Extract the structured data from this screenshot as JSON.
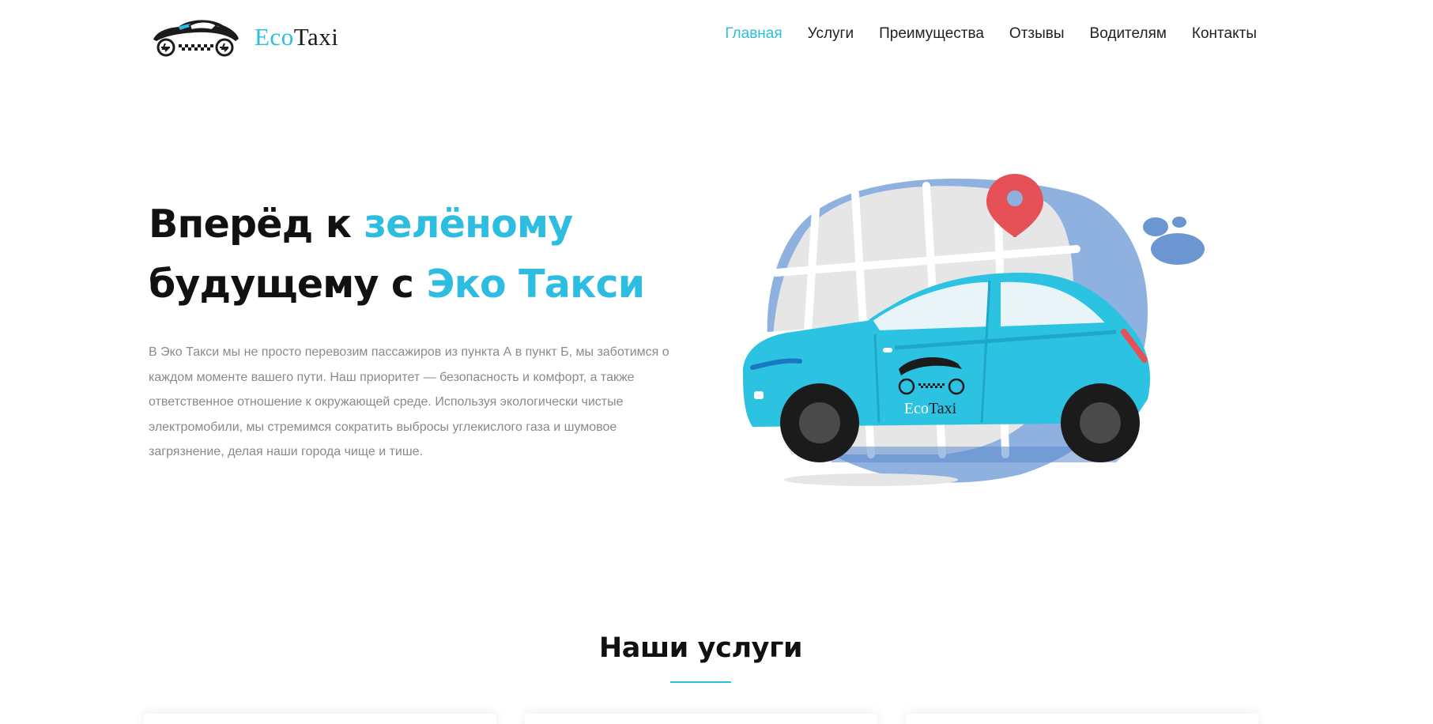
{
  "brand": {
    "name_part1": "Eco",
    "name_part2": "Taxi",
    "colors": {
      "accent": "#2cbde0",
      "text": "#111111",
      "muted": "#8a8a8a"
    }
  },
  "nav": {
    "items": [
      {
        "label": "Главная",
        "active": true
      },
      {
        "label": "Услуги",
        "active": false
      },
      {
        "label": "Преимущества",
        "active": false
      },
      {
        "label": "Отзывы",
        "active": false
      },
      {
        "label": "Водителям",
        "active": false
      },
      {
        "label": "Контакты",
        "active": false
      }
    ]
  },
  "hero": {
    "title_part1": "Вперёд к ",
    "title_accent1": "зелёному",
    "title_part2": "будущему с ",
    "title_accent2": "Эко Такси",
    "description": "В Эко Такси мы не просто перевозим пассажиров из пункта А в пункт Б, мы заботимся о каждом моменте вашего пути. Наш приоритет — безопасность и комфорт, а также ответственное отношение к окружающей среде. Используя экологически чистые электромобили, мы стремимся сократить выбросы углекислого газа и шумовое загрязнение, делая наши города чище и тише.",
    "illustration": {
      "car_logo_part1": "Eco",
      "car_logo_part2": "Taxi",
      "icons": [
        "map-pin-icon",
        "city-map",
        "electric-taxi-car"
      ]
    }
  },
  "services": {
    "title": "Наши услуги"
  }
}
